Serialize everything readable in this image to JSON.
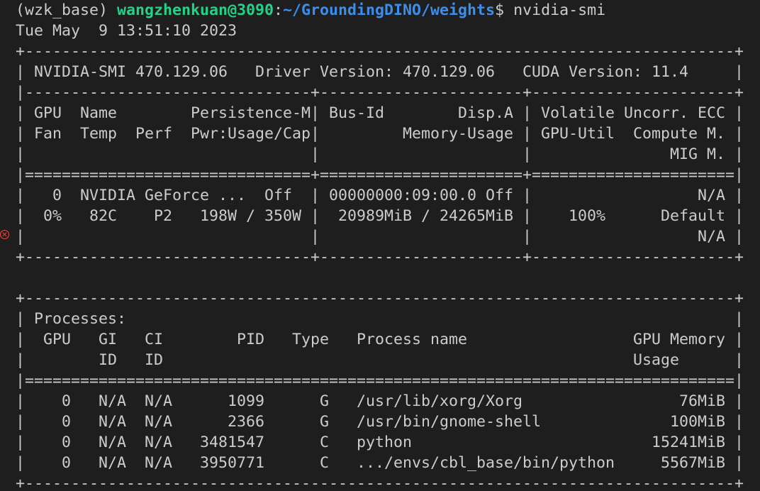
{
  "prompt": {
    "env": "(wzk_base) ",
    "user_host": "wangzhenkuan@3090",
    "separator": ":",
    "path": "~/GroundingDINO/weights",
    "dollar_cmd": "$ nvidia-smi"
  },
  "timestamp": "Tue May  9 13:51:10 2023",
  "gpu_table": [
    "+-----------------------------------------------------------------------------+",
    "| NVIDIA-SMI 470.129.06   Driver Version: 470.129.06   CUDA Version: 11.4     |",
    "|-------------------------------+----------------------+----------------------+",
    "| GPU  Name        Persistence-M| Bus-Id        Disp.A | Volatile Uncorr. ECC |",
    "| Fan  Temp  Perf  Pwr:Usage/Cap|         Memory-Usage | GPU-Util  Compute M. |",
    "|                               |                      |               MIG M. |",
    "|===============================+======================+======================|",
    "|   0  NVIDIA GeForce ...  Off  | 00000000:09:00.0 Off |                  N/A |",
    "|  0%   82C    P2   198W / 350W |  20989MiB / 24265MiB |    100%      Default |",
    "|                               |                      |                  N/A |",
    "+-------------------------------+----------------------+----------------------+"
  ],
  "process_table": [
    "+-----------------------------------------------------------------------------+",
    "| Processes:                                                                  |",
    "|  GPU   GI   CI        PID   Type   Process name                  GPU Memory |",
    "|        ID   ID                                                   Usage      |",
    "|=============================================================================|",
    "|    0   N/A  N/A      1099      G   /usr/lib/xorg/Xorg                 76MiB |",
    "|    0   N/A  N/A      2366      G   /usr/bin/gnome-shell              100MiB |",
    "|    0   N/A  N/A   3481547      C   python                          15241MiB |",
    "|    0   N/A  N/A   3950771      C   .../envs/cbl_base/bin/python     5567MiB |",
    "+-----------------------------------------------------------------------------+"
  ],
  "error_marker_glyph": "✕"
}
